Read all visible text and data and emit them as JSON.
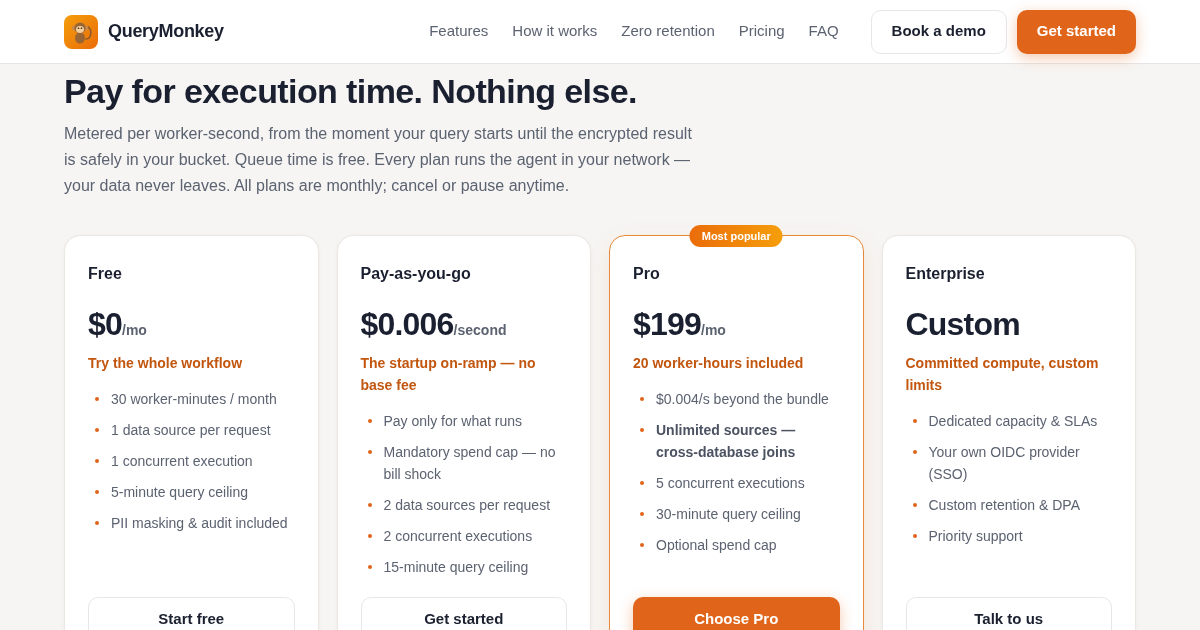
{
  "header": {
    "brand": "QueryMonkey",
    "nav": [
      "Features",
      "How it works",
      "Zero retention",
      "Pricing",
      "FAQ"
    ],
    "actions": [
      {
        "label": "Book a demo",
        "kind": "secondary"
      },
      {
        "label": "Get started",
        "kind": "primary"
      }
    ]
  },
  "hero": {
    "title": "Pay for execution time. Nothing else.",
    "description": "Metered per worker-second, from the moment your query starts until the encrypted result is safely in your bucket. Queue time is free. Every plan runs the agent in your network — your data never leaves. All plans are monthly; cancel or pause anytime."
  },
  "plans": [
    {
      "name": "Free",
      "price": "$0",
      "unit": "/mo",
      "tagline": "Try the whole workflow",
      "featured": false,
      "features": [
        {
          "text": "30 worker-minutes / month",
          "bold": false
        },
        {
          "text": "1 data source per request",
          "bold": false
        },
        {
          "text": "1 concurrent execution",
          "bold": false
        },
        {
          "text": "5-minute query ceiling",
          "bold": false
        },
        {
          "text": "PII masking & audit included",
          "bold": false
        }
      ],
      "cta": "Start free"
    },
    {
      "name": "Pay-as-you-go",
      "price": "$0.006",
      "unit": "/second",
      "tagline": "The startup on-ramp — no base fee",
      "featured": false,
      "features": [
        {
          "text": "Pay only for what runs",
          "bold": false
        },
        {
          "text": "Mandatory spend cap — no bill shock",
          "bold": false
        },
        {
          "text": "2 data sources per request",
          "bold": false
        },
        {
          "text": "2 concurrent executions",
          "bold": false
        },
        {
          "text": "15-minute query ceiling",
          "bold": false
        }
      ],
      "cta": "Get started"
    },
    {
      "name": "Pro",
      "badge": "Most popular",
      "price": "$199",
      "unit": "/mo",
      "tagline": "20 worker-hours included",
      "featured": true,
      "features": [
        {
          "text": "$0.004/s beyond the bundle",
          "bold": false
        },
        {
          "text": "Unlimited sources — cross-database joins",
          "bold": true
        },
        {
          "text": "5 concurrent executions",
          "bold": false
        },
        {
          "text": "30-minute query ceiling",
          "bold": false
        },
        {
          "text": "Optional spend cap",
          "bold": false
        }
      ],
      "cta": "Choose Pro"
    },
    {
      "name": "Enterprise",
      "price": "Custom",
      "tagline": "Committed compute, custom limits",
      "featured": false,
      "features": [
        {
          "text": "Dedicated capacity & SLAs",
          "bold": false
        },
        {
          "text": "Your own OIDC provider (SSO)",
          "bold": false
        },
        {
          "text": "Custom retention & DPA",
          "bold": false
        },
        {
          "text": "Priority support",
          "bold": false
        }
      ],
      "cta": "Talk to us"
    }
  ]
}
